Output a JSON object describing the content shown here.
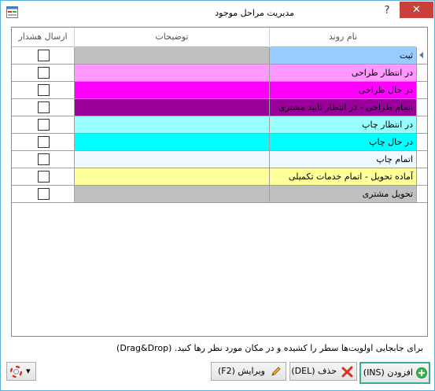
{
  "window": {
    "title": "مدیریت مراحل موجود",
    "help_label": "?",
    "close_label": "✕"
  },
  "grid": {
    "columns": {
      "name": "نام روند",
      "description": "توضیحات",
      "alert": "ارسال هشدار"
    },
    "rows": [
      {
        "name": "ثبت",
        "color": "#c0c0c0",
        "name_color": "#99ccff",
        "selected": true
      },
      {
        "name": "در انتظار طراحی",
        "color": "#ff99ff"
      },
      {
        "name": "در حال طراحی",
        "color": "#ff00ff"
      },
      {
        "name": "اتمام طراحی - در انتظار تایید مشتری",
        "color": "#990099"
      },
      {
        "name": "در انتظار چاپ",
        "color": "#99ffff"
      },
      {
        "name": "در حال چاپ",
        "color": "#00ffff"
      },
      {
        "name": "اتمام چاپ",
        "color": "#f0f8ff"
      },
      {
        "name": "آماده تحویل - اتمام خدمات تکمیلی",
        "color": "#ffff99"
      },
      {
        "name": "تحویل مشتری",
        "color": "#c0c0c0"
      }
    ]
  },
  "hint": "برای جابجایی اولویت‌ها سطر را کشیده و در مکان مورد نظر رها کنید. (Drag&Drop)",
  "buttons": {
    "add": "افزودن (INS)",
    "delete": "حذف (DEL)",
    "edit": "ویرایش (F2)",
    "help": "▾"
  },
  "icons": {
    "add": "plus-circle-icon",
    "delete": "x-icon",
    "edit": "pencil-icon",
    "help": "lifebuoy-icon",
    "app": "form-icon"
  }
}
